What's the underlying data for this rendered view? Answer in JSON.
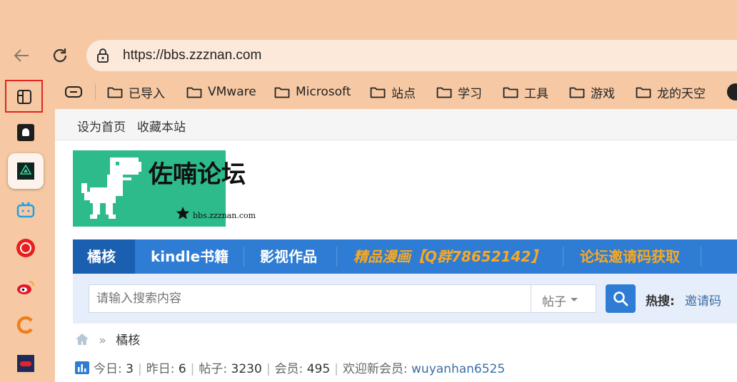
{
  "browser": {
    "url": "https://bbs.zzznan.com",
    "bookmarks": [
      "已导入",
      "VMware",
      "Microsoft",
      "站点",
      "学习",
      "工具",
      "游戏",
      "龙的天空"
    ]
  },
  "sidebar": {
    "icons": [
      "sidebar-toggle-icon",
      "app-icon-1",
      "app-icon-2",
      "bilibili-icon",
      "netease-music-icon",
      "weibo-icon",
      "c-app-icon",
      "game-icon"
    ]
  },
  "forum": {
    "topbar": {
      "set_home": "设为首页",
      "bookmark": "收藏本站"
    },
    "logo": {
      "title": "佐喃论坛",
      "url": "bbs.zzznan.com"
    },
    "nav": [
      {
        "label": "橘核"
      },
      {
        "label": "kindle书籍"
      },
      {
        "label": "影视作品"
      },
      {
        "label": "精品漫画【Q群78652142】"
      },
      {
        "label": "论坛邀请码获取"
      }
    ],
    "search": {
      "placeholder": "请输入搜索内容",
      "type": "帖子",
      "hot_label": "热搜:",
      "hot_keyword": "邀请码"
    },
    "breadcrumb": {
      "sep": "»",
      "current": "橘核"
    },
    "stats": {
      "today_label": "今日:",
      "today": "3",
      "yesterday_label": "昨日:",
      "yesterday": "6",
      "posts_label": "帖子:",
      "posts": "3230",
      "members_label": "会员:",
      "members": "495",
      "welcome_label": "欢迎新会员:",
      "new_member": "wuyanhan6525"
    }
  },
  "colors": {
    "accent": "#2e7cd3",
    "nav_orange": "#f7a823",
    "link": "#3b6ea5",
    "frame": "#f6c9a4"
  }
}
